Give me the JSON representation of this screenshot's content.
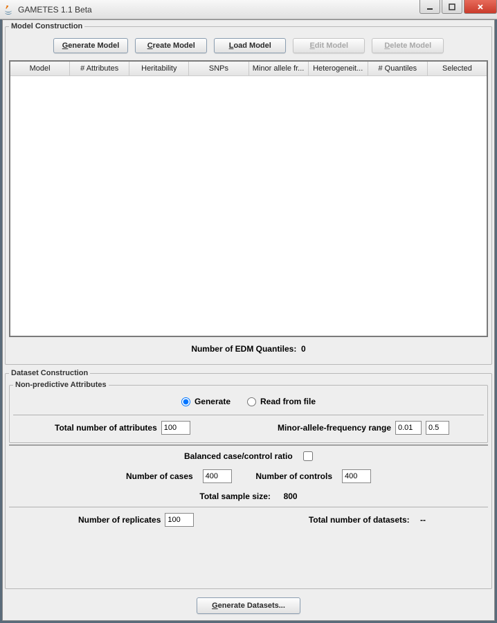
{
  "window": {
    "title": "GAMETES 1.1 Beta"
  },
  "model_construction": {
    "legend": "Model Construction",
    "buttons": {
      "generate": "Generate Model",
      "create": "Create Model",
      "load": "Load Model",
      "edit": "Edit Model",
      "delete": "Delete Model"
    },
    "table_headers": {
      "model": "Model",
      "attributes": "# Attributes",
      "heritability": "Heritability",
      "snps": "SNPs",
      "minor_allele": "Minor allele fr...",
      "heterogeneity": "Heterogeneit...",
      "quantiles": "# Quantiles",
      "selected": "Selected"
    },
    "edm_label": "Number of EDM Quantiles:",
    "edm_value": "0"
  },
  "dataset_construction": {
    "legend": "Dataset Construction",
    "non_predictive": {
      "legend": "Non-predictive Attributes",
      "radio_generate": "Generate",
      "radio_readfile": "Read from file",
      "total_attrs_label": "Total number of attributes",
      "total_attrs_value": "100",
      "maf_label": "Minor-allele-frequency range",
      "maf_min": "0.01",
      "maf_max": "0.5"
    },
    "balanced_label": "Balanced case/control ratio",
    "cases_label": "Number of cases",
    "cases_value": "400",
    "controls_label": "Number of controls",
    "controls_value": "400",
    "total_sample_label": "Total sample size:",
    "total_sample_value": "800",
    "replicates_label": "Number of replicates",
    "replicates_value": "100",
    "total_datasets_label": "Total number of datasets:",
    "total_datasets_value": "--",
    "generate_btn": "Generate Datasets..."
  }
}
